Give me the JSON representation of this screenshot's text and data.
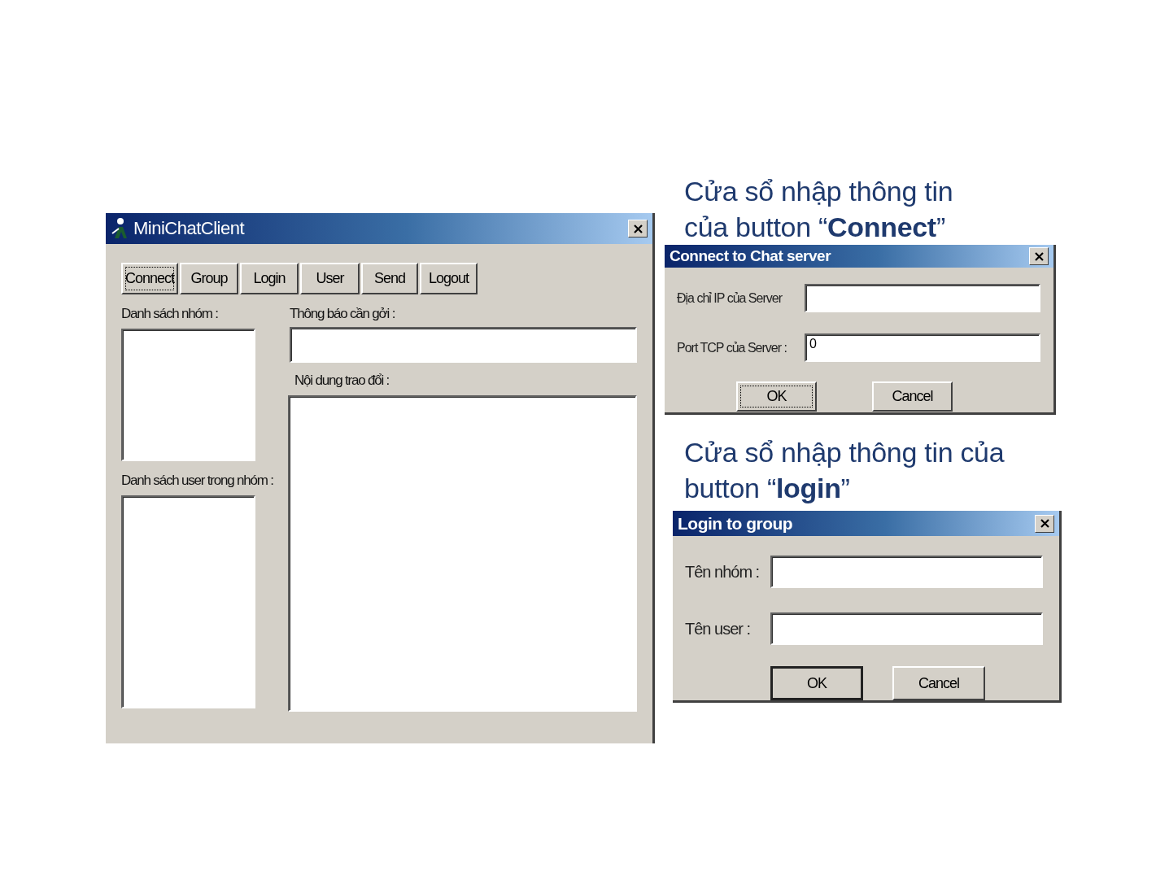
{
  "main_window": {
    "title": "MiniChatClient",
    "toolbar": [
      {
        "label": "Connect",
        "focused": true
      },
      {
        "label": "Group",
        "focused": false
      },
      {
        "label": "Login",
        "focused": false
      },
      {
        "label": "User",
        "focused": false
      },
      {
        "label": "Send",
        "focused": false
      },
      {
        "label": "Logout",
        "focused": false
      }
    ],
    "group_list_label": "Danh sách nhóm :",
    "user_list_label": "Danh sách user trong nhóm :",
    "message_label": "Thông báo cần gởi :",
    "conversation_label": "Nội dung trao đổi :"
  },
  "connect_caption": "Cửa sổ nhập thông tin\ncủa button “**Connect**”",
  "connect_dialog": {
    "title": "Connect to Chat server",
    "fields": [
      {
        "label": "Địa chỉ IP của Server"
      },
      {
        "label": "Port TCP của Server :",
        "value": "0"
      }
    ],
    "buttons": [
      {
        "label": "OK",
        "focused": true
      },
      {
        "label": "Cancel",
        "focused": false
      }
    ]
  },
  "login_caption": "Cửa sổ nhập thông tin của\nbutton “**login**”",
  "login_dialog": {
    "title": "Login to group",
    "fields": [
      {
        "label": "Tên nhóm :"
      },
      {
        "label": "Tên user :"
      }
    ],
    "buttons": [
      {
        "label": "OK",
        "default": true
      },
      {
        "label": "Cancel",
        "default": false
      }
    ]
  }
}
